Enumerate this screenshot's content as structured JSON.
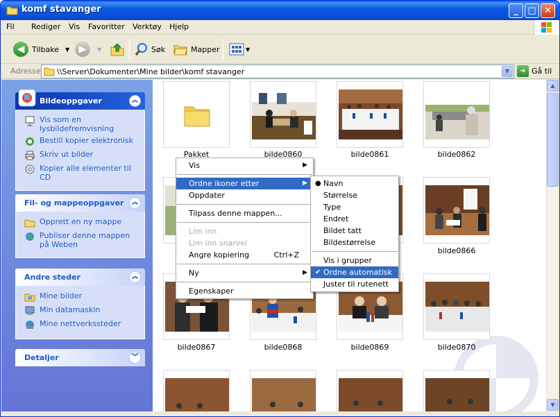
{
  "window": {
    "title": "komf stavanger",
    "min_glyph": "_",
    "max_glyph": "□",
    "close_glyph": "✕"
  },
  "menubar": [
    "Fil",
    "Rediger",
    "Vis",
    "Favoritter",
    "Verktøy",
    "Hjelp"
  ],
  "toolbar": {
    "back": "Tilbake",
    "search": "Søk",
    "folders": "Mapper"
  },
  "address": {
    "label": "Adresse",
    "path": "\\\\Server\\Dokumenter\\Mine bilder\\komf stavanger",
    "go": "Gå til"
  },
  "taskpane": {
    "image_tasks": {
      "title": "Bildeoppgaver",
      "links": [
        "Vis som en lysbildefremvisning",
        "Bestill kopier elektronisk",
        "Skriv ut bilder",
        "Kopier alle elementer til CD"
      ]
    },
    "file_tasks": {
      "title": "Fil- og mappeoppgaver",
      "links": [
        "Opprett en ny mappe",
        "Publiser denne mappen på Weben"
      ]
    },
    "other_places": {
      "title": "Andre steder",
      "links": [
        "Mine bilder",
        "Min datamaskin",
        "Mine nettverkssteder"
      ]
    },
    "details": {
      "title": "Detaljer"
    }
  },
  "items": [
    {
      "name": "Pakket",
      "kind": "folder"
    },
    {
      "name": "bilde0860"
    },
    {
      "name": "bilde0861"
    },
    {
      "name": "bilde0862"
    },
    {
      "name": ""
    },
    {
      "name": ""
    },
    {
      "name": ""
    },
    {
      "name": "bilde0866"
    },
    {
      "name": "bilde0867"
    },
    {
      "name": "bilde0868"
    },
    {
      "name": "bilde0869"
    },
    {
      "name": "bilde0870"
    },
    {
      "name": ""
    },
    {
      "name": ""
    },
    {
      "name": ""
    },
    {
      "name": ""
    }
  ],
  "context_menu": {
    "items": [
      {
        "label": "Vis",
        "submenu": true
      },
      {
        "separator": true
      },
      {
        "label": "Ordne ikoner etter",
        "submenu": true,
        "highlighted": true
      },
      {
        "label": "Oppdater"
      },
      {
        "separator": true
      },
      {
        "label": "Tilpass denne mappen..."
      },
      {
        "separator": true
      },
      {
        "label": "Lim inn",
        "disabled": true
      },
      {
        "label": "Lim inn snarvei",
        "disabled": true
      },
      {
        "label": "Angre kopiering",
        "shortcut": "Ctrl+Z"
      },
      {
        "separator": true
      },
      {
        "label": "Ny",
        "submenu": true
      },
      {
        "separator": true
      },
      {
        "label": "Egenskaper"
      }
    ]
  },
  "submenu": {
    "items": [
      {
        "label": "Navn",
        "mark": "bullet"
      },
      {
        "label": "Størrelse"
      },
      {
        "label": "Type"
      },
      {
        "label": "Endret"
      },
      {
        "label": "Bildet tatt"
      },
      {
        "label": "Bildestørrelse"
      },
      {
        "separator": true
      },
      {
        "label": "Vis i grupper"
      },
      {
        "label": "Ordne automatisk",
        "mark": "check",
        "highlighted": true
      },
      {
        "label": "Juster til rutenett"
      }
    ]
  },
  "colors": {
    "titlebar": "#0A5FE8",
    "taskpane": "#6375D6",
    "menu_highlight": "#316AC5",
    "link": "#215DC6"
  }
}
